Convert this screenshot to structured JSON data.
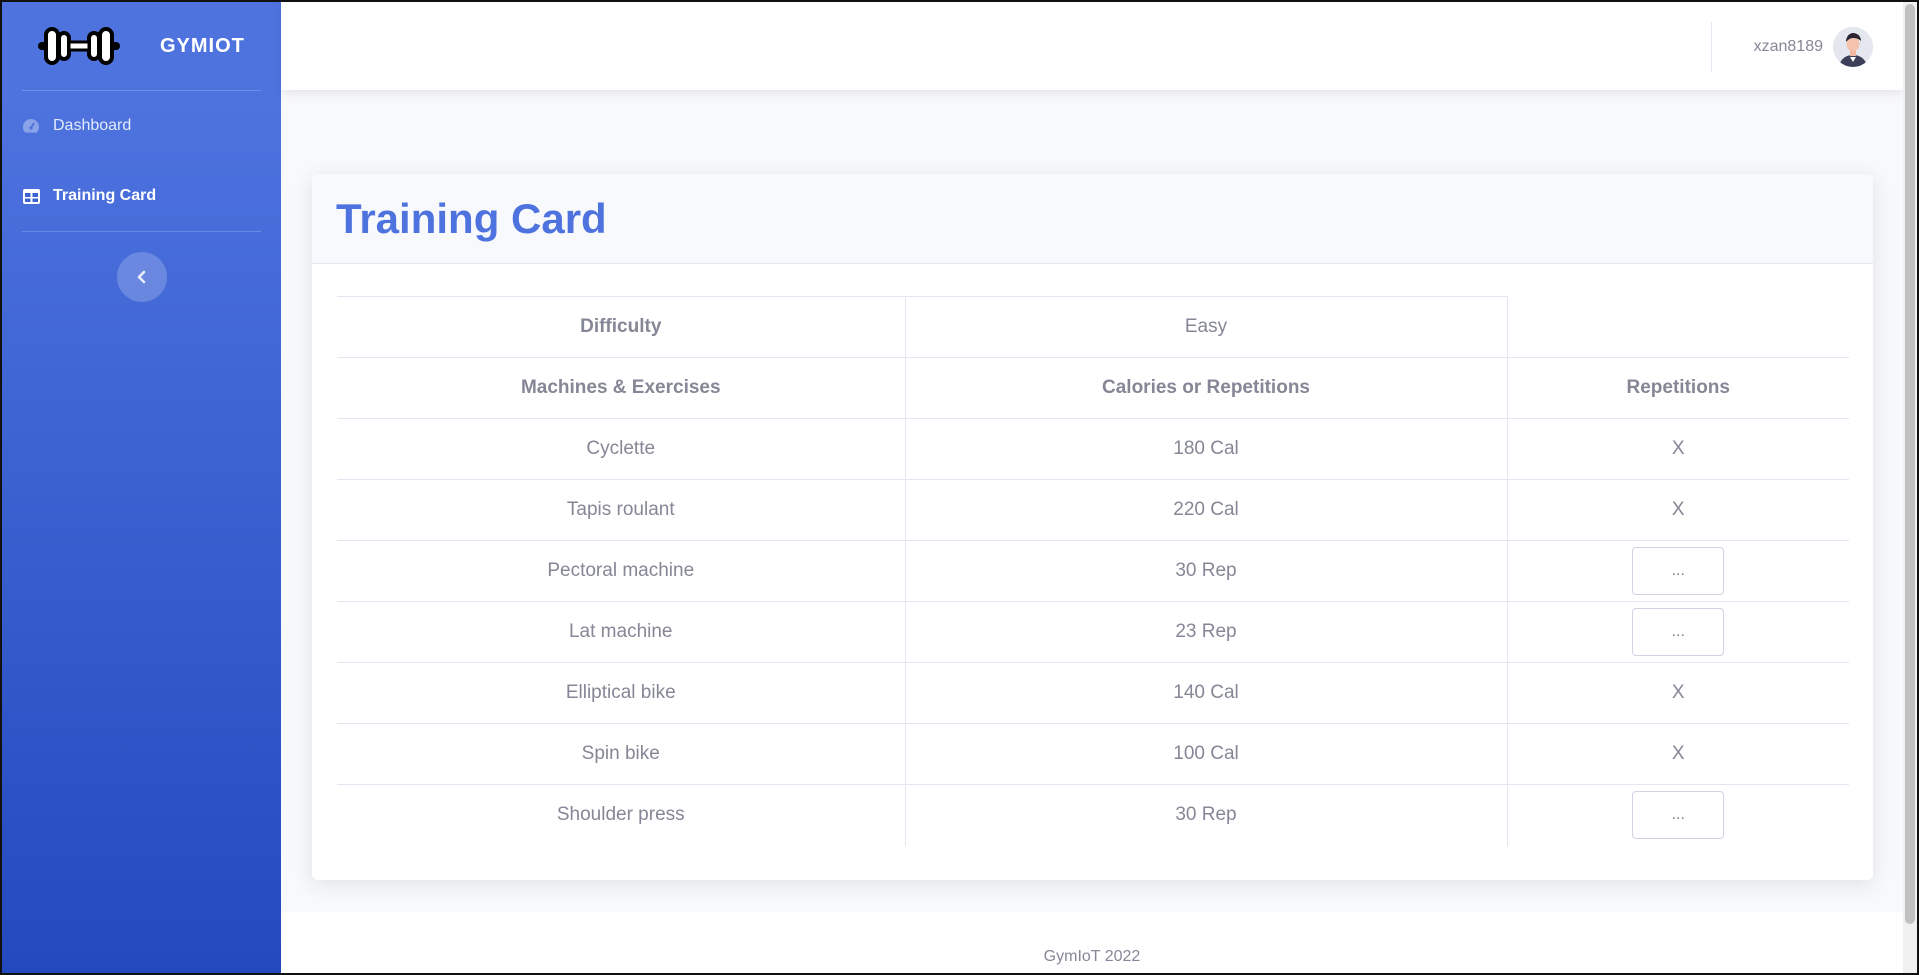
{
  "brand": {
    "name": "GYMIOT",
    "logo_icon": "dumbbell-icon"
  },
  "sidebar": {
    "items": [
      {
        "label": "Dashboard",
        "icon": "tachometer-icon"
      },
      {
        "label": "Training Card",
        "icon": "table-icon"
      }
    ],
    "toggle_icon": "chevron-left-icon"
  },
  "topbar": {
    "username": "xzan8189",
    "avatar_icon": "user-avatar"
  },
  "card": {
    "title": "Training Card",
    "difficulty": {
      "label": "Difficulty",
      "value": "Easy"
    },
    "columns": [
      "Machines & Exercises",
      "Calories or Repetitions",
      "Repetitions"
    ],
    "rows": [
      {
        "exercise": "Cyclette",
        "amount": "180 Cal",
        "repetitions": "X"
      },
      {
        "exercise": "Tapis roulant",
        "amount": "220 Cal",
        "repetitions": "X"
      },
      {
        "exercise": "Pectoral machine",
        "amount": "30 Rep",
        "repetitions": "..."
      },
      {
        "exercise": "Lat machine",
        "amount": "23 Rep",
        "repetitions": "..."
      },
      {
        "exercise": "Elliptical bike",
        "amount": "140 Cal",
        "repetitions": "X"
      },
      {
        "exercise": "Spin bike",
        "amount": "100 Cal",
        "repetitions": "X"
      },
      {
        "exercise": "Shoulder press",
        "amount": "30 Rep",
        "repetitions": "..."
      }
    ]
  },
  "footer": {
    "text": "GymIoT 2022"
  },
  "colors": {
    "primary": "#4e73df",
    "primary_dark": "#224abe",
    "text_muted": "#858796"
  }
}
